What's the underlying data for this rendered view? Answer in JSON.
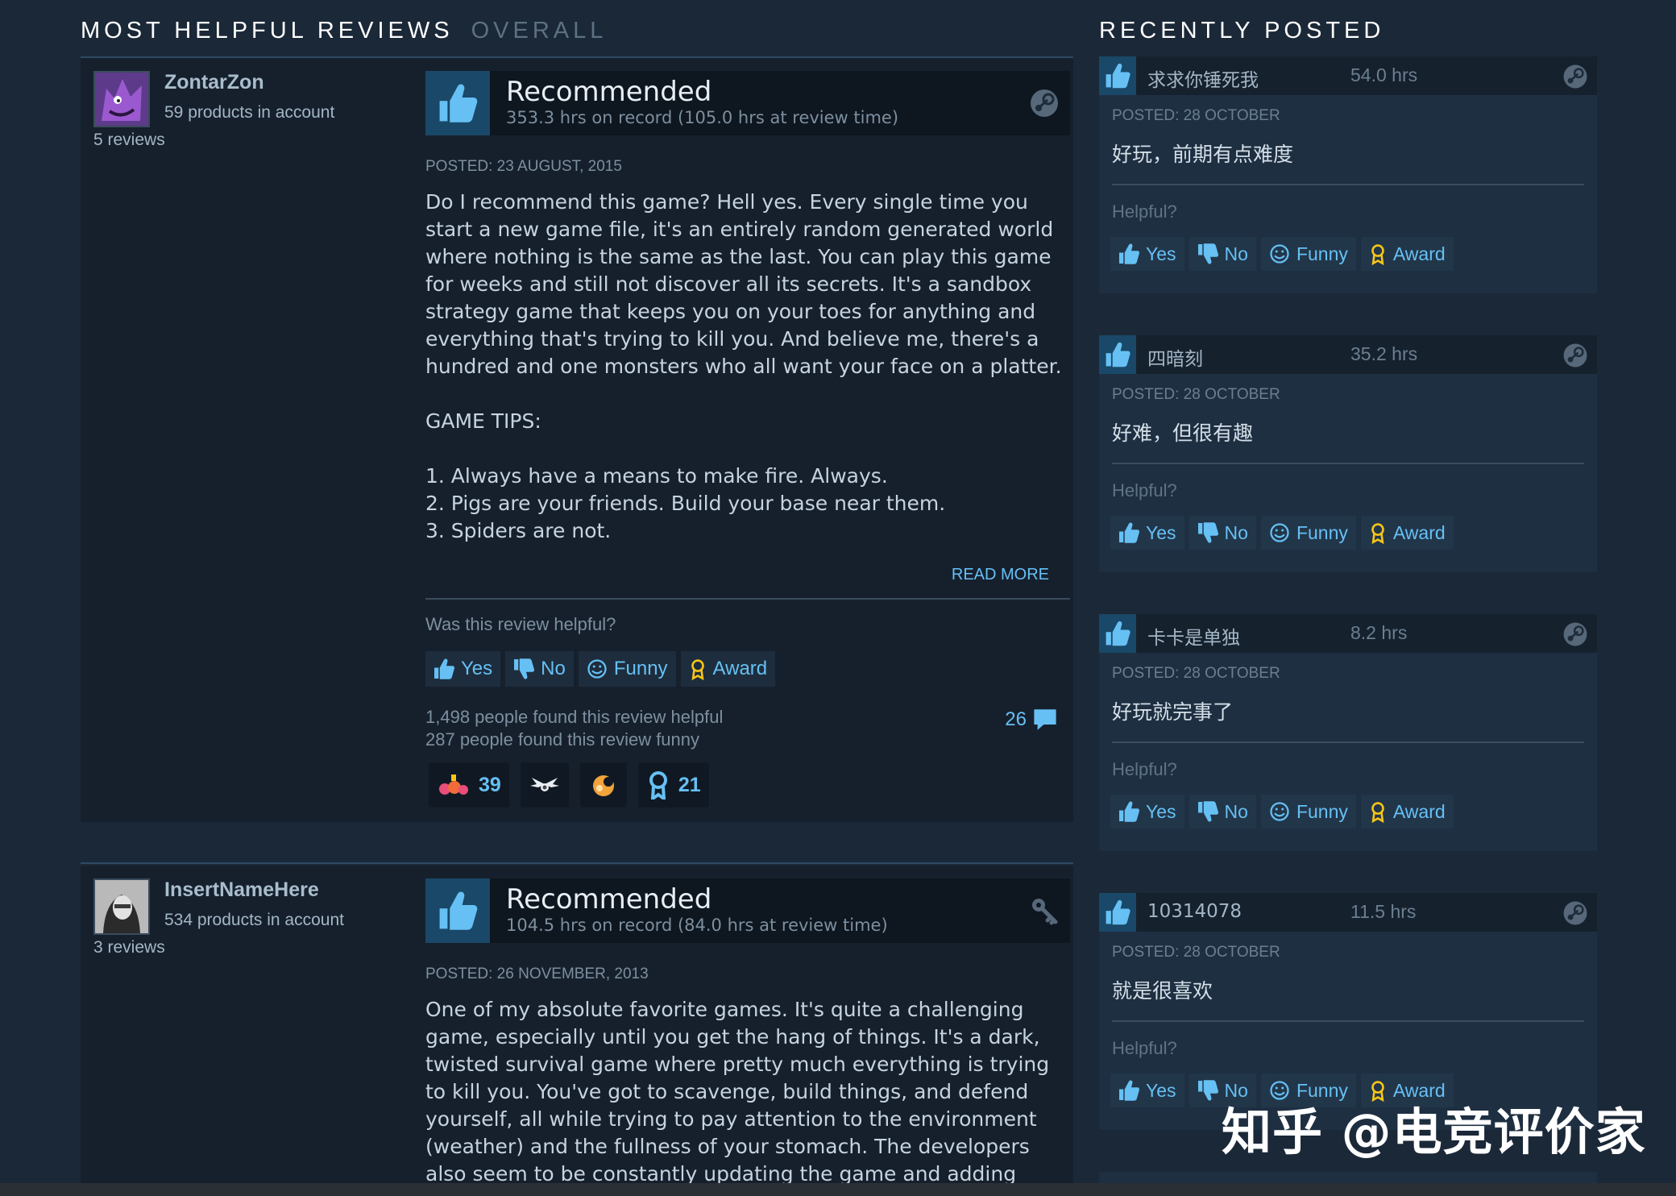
{
  "left_header": {
    "active_tab": "MOST HELPFUL REVIEWS",
    "inactive_tab": "OVERALL"
  },
  "right_header": {
    "title": "RECENTLY POSTED"
  },
  "reviews": [
    {
      "author": "ZontarZon",
      "products": "59 products in account",
      "review_count": "5 reviews",
      "verdict": "Recommended",
      "hours": "353.3 hrs on record (105.0 hrs at review time)",
      "posted": "POSTED: 23 AUGUST, 2015",
      "body": "Do I recommend this game? Hell yes. Every single time you start a new game file, it's an entirely random generated world where nothing is the same as the last. You can play this game for weeks and still not discover all its secrets. It's a sandbox strategy game that keeps you on your toes for anything and everything that's trying to kill you. And believe me, there's a hundred and one monsters who all want your face on a platter.\n\nGAME TIPS:\n\n1. Always have a means to make fire. Always.\n2. Pigs are your friends. Build your base near them.\n3. Spiders are not.",
      "read_more": "READ MORE",
      "helpful_prompt": "Was this review helpful?",
      "buttons": {
        "yes": "Yes",
        "no": "No",
        "funny": "Funny",
        "award": "Award"
      },
      "helpful_count": "1,498 people found this review helpful",
      "funny_count": "287 people found this review funny",
      "comment_count": "26",
      "awards": [
        {
          "icon": "party-award-icon",
          "count": "39"
        },
        {
          "icon": "winged-award-icon",
          "count": ""
        },
        {
          "icon": "tasty-award-icon",
          "count": ""
        },
        {
          "icon": "medal-award-icon",
          "count": "21"
        }
      ]
    },
    {
      "author": "InsertNameHere",
      "products": "534 products in account",
      "review_count": "3 reviews",
      "verdict": "Recommended",
      "hours": "104.5 hrs on record (84.0 hrs at review time)",
      "posted": "POSTED: 26 NOVEMBER, 2013",
      "body": "One of my absolute favorite games. It's quite a challenging game, especially until you get the hang of things. It's a dark, twisted survival game where pretty much everything is trying to kill you. You've got to scavenge, build things, and defend yourself, all while trying to pay attention to the environment (weather) and the fullness of your stomach. The developers also seem to be constantly updating the game and adding huge"
    }
  ],
  "recent": [
    {
      "name": "求求你锤死我",
      "hrs": "54.0 hrs",
      "posted": "POSTED: 28 OCTOBER",
      "text": "好玩，前期有点难度"
    },
    {
      "name": "四暗刻",
      "hrs": "35.2 hrs",
      "posted": "POSTED: 28 OCTOBER",
      "text": "好难，但很有趣"
    },
    {
      "name": "卡卡是单独",
      "hrs": "8.2 hrs",
      "posted": "POSTED: 28 OCTOBER",
      "text": "好玩就完事了"
    },
    {
      "name": "10314078",
      "hrs": "11.5 hrs",
      "posted": "POSTED: 28 OCTOBER",
      "text": "就是很喜欢"
    }
  ],
  "recent_labels": {
    "helpful": "Helpful?",
    "yes": "Yes",
    "no": "No",
    "funny": "Funny",
    "award": "Award"
  },
  "watermark": "知乎 @电竞评价家",
  "colors": {
    "background": "#1b2838",
    "panel": "#16202d",
    "link": "#66c0f4",
    "thumb_bg": "#1a4868",
    "award_gold": "#f5c518"
  }
}
